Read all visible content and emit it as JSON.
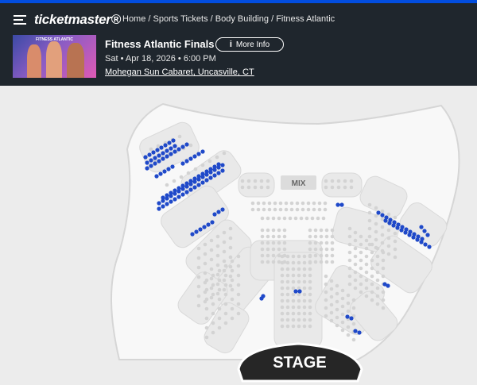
{
  "header": {
    "logo": "ticketmaster®",
    "breadcrumb": "Home / Sports Tickets / Body Building / Fitness Atlantic",
    "thumbnail_caption": "FITNESS ATLANTIC"
  },
  "event": {
    "title": "Fitness Atlantic Finals",
    "more_info_label": "More Info",
    "date": "Sat • Apr 18, 2026 • 6:00 PM",
    "venue": "Mohegan Sun Cabaret, Uncasville, CT"
  },
  "map": {
    "mix_label": "MIX",
    "stage_label": "STAGE",
    "colors": {
      "available": "#1f49c9",
      "unavailable": "#d3d3d3",
      "section": "#f7f7f7",
      "stage": "#262626",
      "header": "#1f262d"
    }
  }
}
